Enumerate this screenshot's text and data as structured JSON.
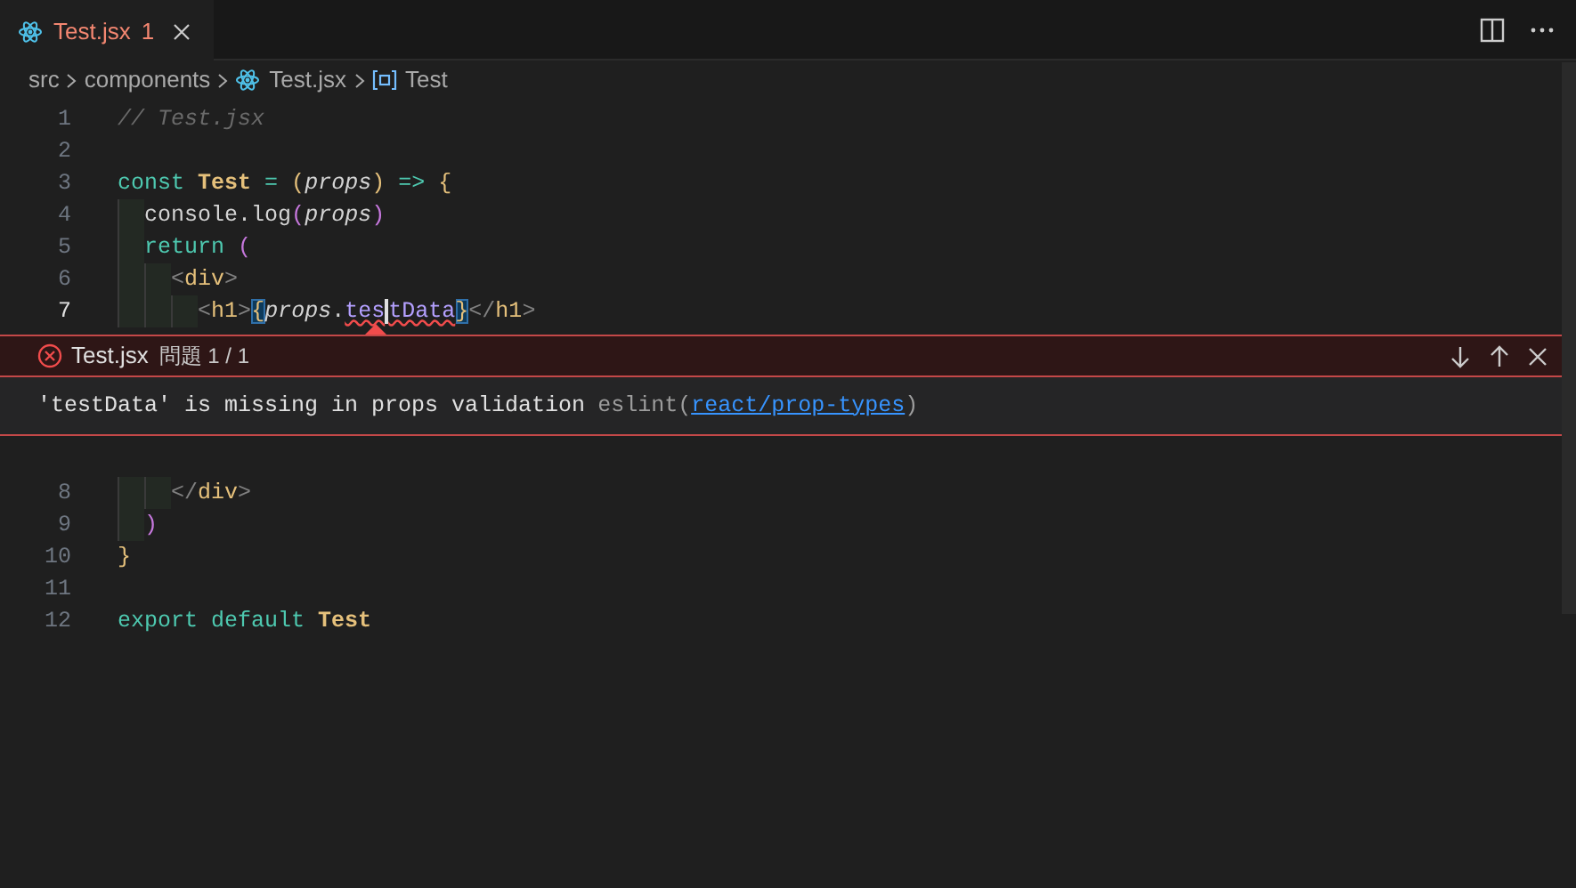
{
  "tab": {
    "label": "Test.jsx",
    "problem_count": "1",
    "selected": true
  },
  "breadcrumbs": [
    {
      "label": "src",
      "kind": "folder"
    },
    {
      "label": "components",
      "kind": "folder"
    },
    {
      "label": "Test.jsx",
      "kind": "react"
    },
    {
      "label": "Test",
      "kind": "symbol"
    }
  ],
  "code_before": [
    {
      "number": "1",
      "current": false,
      "tokens": [
        {
          "text": "// Test.jsx",
          "kind": "comment"
        }
      ]
    },
    {
      "number": "2",
      "current": false
    },
    {
      "number": "3",
      "current": false,
      "tokens": [
        {
          "text": "const ",
          "kind": "keyword"
        },
        {
          "text": "Test",
          "kind": "name"
        },
        {
          "text": " = ",
          "kind": "operator"
        },
        {
          "text": "(",
          "kind": "bracket"
        },
        {
          "text": "props",
          "kind": "param"
        },
        {
          "text": ")",
          "kind": "bracket"
        },
        {
          "text": " => ",
          "kind": "operator"
        },
        {
          "text": "{",
          "kind": "brace"
        }
      ]
    },
    {
      "number": "4",
      "current": false,
      "tokens": [
        {
          "text": "  console.",
          "kind": "plain"
        },
        {
          "text": "log",
          "kind": "plain"
        },
        {
          "text": "(",
          "kind": "paren"
        },
        {
          "text": "props",
          "kind": "param"
        },
        {
          "text": ")",
          "kind": "paren"
        }
      ]
    },
    {
      "number": "5",
      "current": false,
      "tokens": [
        {
          "text": "  return ",
          "kind": "keyword"
        },
        {
          "text": "(",
          "kind": "paren"
        }
      ]
    },
    {
      "number": "6",
      "current": false,
      "tokens": [
        {
          "text": "    <",
          "kind": "angle"
        },
        {
          "text": "div",
          "kind": "tag"
        },
        {
          "text": ">",
          "kind": "angle"
        }
      ]
    },
    {
      "number": "7",
      "current": true,
      "tokens": [
        {
          "text": "      <",
          "kind": "angle"
        },
        {
          "text": "h1",
          "kind": "tag"
        },
        {
          "text": ">",
          "kind": "angle"
        },
        {
          "text": "{",
          "kind": "brace",
          "matched": true
        },
        {
          "text": "props",
          "kind": "param"
        },
        {
          "text": ".",
          "kind": "plain"
        },
        {
          "text": "tes",
          "kind": "property",
          "squiggle": true,
          "cursor_after": true
        },
        {
          "text": "tData",
          "kind": "property",
          "squiggle": true
        },
        {
          "text": "}",
          "kind": "brace",
          "matched": true
        },
        {
          "text": "</",
          "kind": "angle"
        },
        {
          "text": "h1",
          "kind": "tag"
        },
        {
          "text": ">",
          "kind": "angle"
        }
      ]
    }
  ],
  "peek": {
    "file": "Test.jsx",
    "counter": "問題 1 / 1",
    "message": "'testData' is missing in props validation",
    "source_prefix": "eslint(",
    "rule_link": "react/prop-types",
    "source_suffix": ")"
  },
  "code_after": [
    {
      "number": "8",
      "current": false,
      "tokens": [
        {
          "text": "    </",
          "kind": "angle"
        },
        {
          "text": "div",
          "kind": "tag"
        },
        {
          "text": ">",
          "kind": "angle"
        }
      ]
    },
    {
      "number": "9",
      "current": false,
      "tokens": [
        {
          "text": "  )",
          "kind": "paren"
        }
      ]
    },
    {
      "number": "10",
      "current": false,
      "tokens": [
        {
          "text": "}",
          "kind": "brace"
        }
      ]
    },
    {
      "number": "11",
      "current": false
    },
    {
      "number": "12",
      "current": false,
      "tokens": [
        {
          "text": "export default ",
          "kind": "keyword"
        },
        {
          "text": "Test",
          "kind": "name"
        }
      ]
    }
  ]
}
